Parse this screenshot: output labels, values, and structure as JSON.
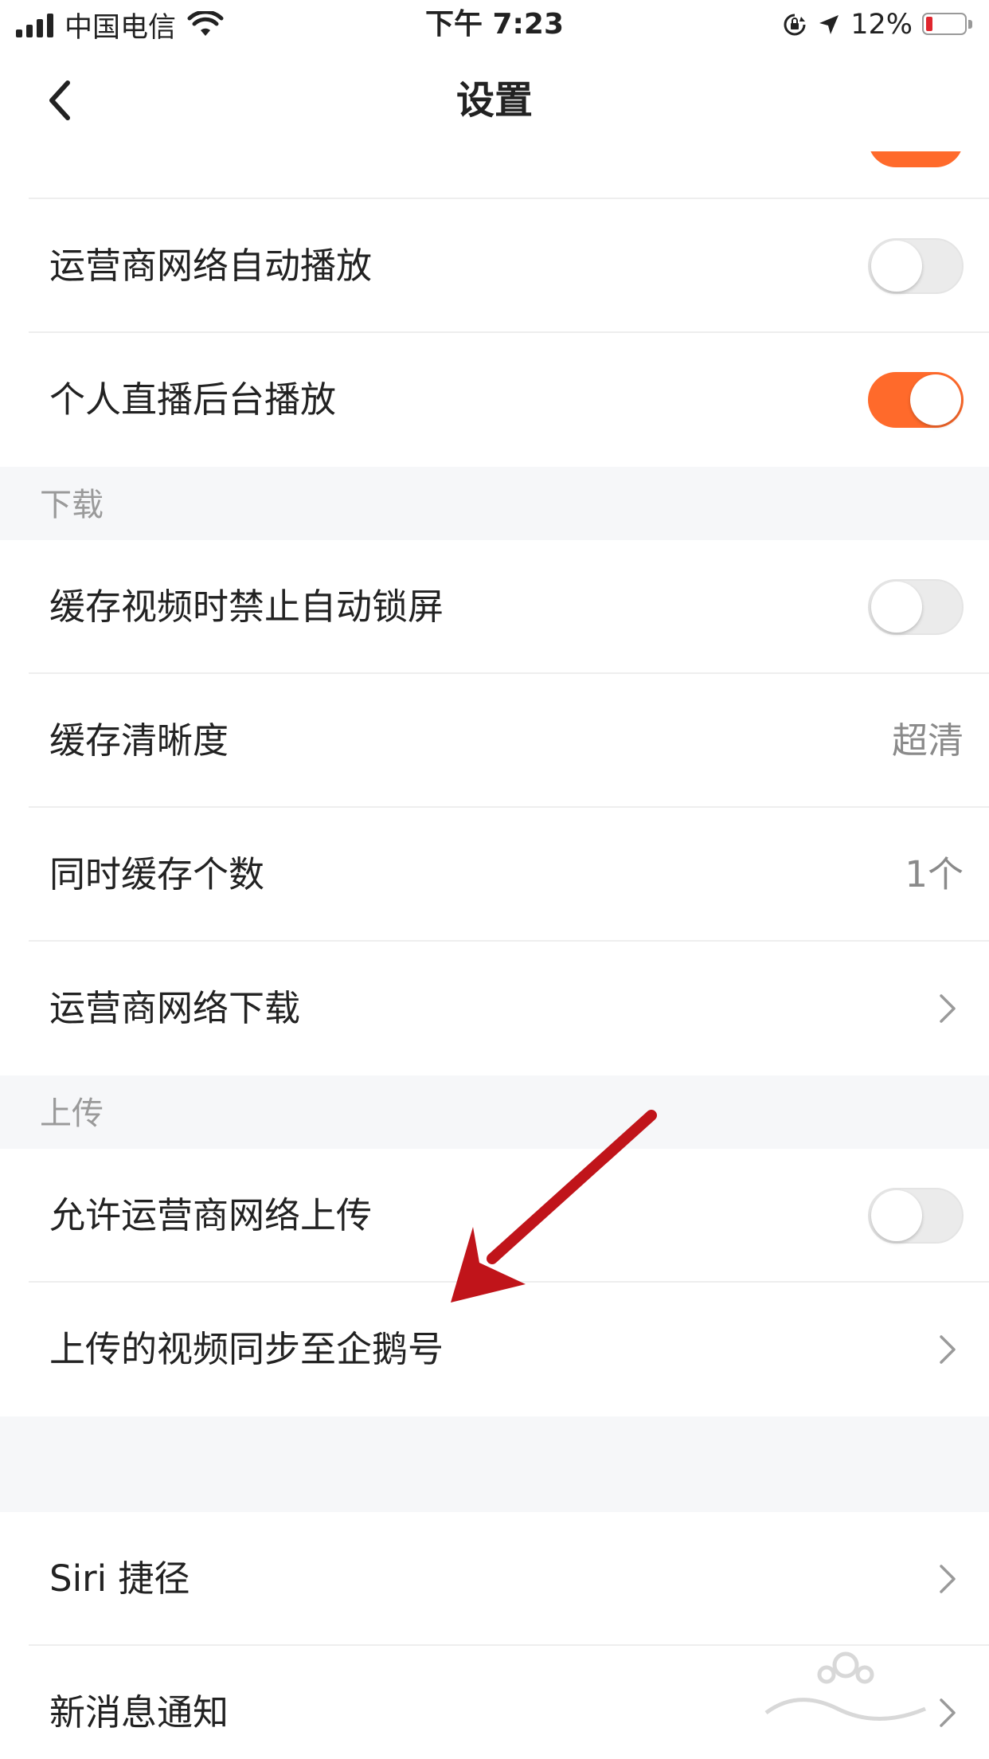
{
  "status_bar": {
    "carrier": "中国电信",
    "time": "下午 7:23",
    "battery": "12%"
  },
  "nav": {
    "title": "设置"
  },
  "sections": {
    "top_rows": [
      {
        "label": "运营商网络自动播放",
        "control": "toggle",
        "on": false
      },
      {
        "label": "个人直播后台播放",
        "control": "toggle",
        "on": true
      }
    ],
    "download": {
      "header": "下载",
      "rows": [
        {
          "label": "缓存视频时禁止自动锁屏",
          "control": "toggle",
          "on": false
        },
        {
          "label": "缓存清晰度",
          "value": "超清"
        },
        {
          "label": "同时缓存个数",
          "value": "1个"
        },
        {
          "label": "运营商网络下载",
          "control": "chevron"
        }
      ]
    },
    "upload": {
      "header": "上传",
      "rows": [
        {
          "label": "允许运营商网络上传",
          "control": "toggle",
          "on": false
        },
        {
          "label": "上传的视频同步至企鹅号",
          "control": "chevron"
        }
      ]
    },
    "other": {
      "rows": [
        {
          "label": "Siri 捷径",
          "control": "chevron"
        },
        {
          "label": "新消息通知",
          "control": "chevron"
        }
      ]
    }
  },
  "colors": {
    "accent": "#ff6a2b",
    "background_gray": "#f6f7f9",
    "annotation_arrow": "#c0141a"
  },
  "icons": {
    "back": "chevron-left-icon",
    "row_arrow": "chevron-right-icon",
    "wifi": "wifi-icon",
    "signal": "signal-icon",
    "battery": "battery-icon",
    "location": "location-arrow-icon",
    "orientation_lock": "orientation-lock-icon"
  }
}
